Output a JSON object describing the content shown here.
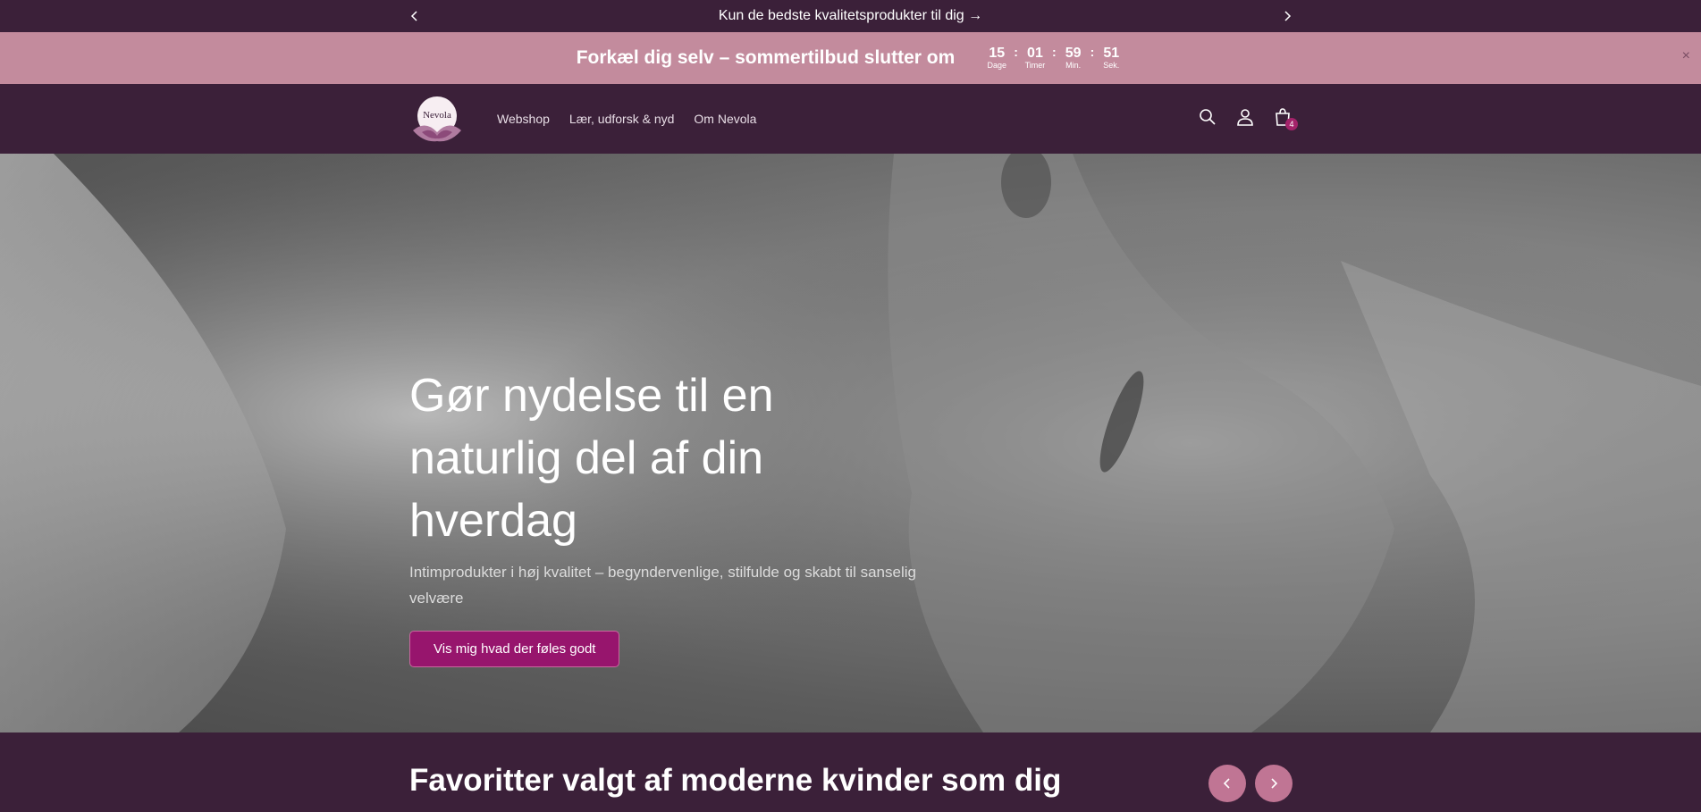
{
  "announcement": {
    "text": "Kun de bedste kvalitetsprodukter til dig →"
  },
  "countdown": {
    "title": "Forkæl dig selv – sommertilbud slutter om",
    "units": [
      {
        "value": "15",
        "label": "Dage"
      },
      {
        "value": "01",
        "label": "Timer"
      },
      {
        "value": "59",
        "label": "Min."
      },
      {
        "value": "51",
        "label": "Sek."
      }
    ],
    "separator": ":",
    "close": "×"
  },
  "header": {
    "logo_text": "Nevola",
    "nav": [
      "Webshop",
      "Lær, udforsk & nyd",
      "Om Nevola"
    ],
    "cart_count": "4"
  },
  "hero": {
    "title": "Gør nydelse til en naturlig del af din hverdag",
    "subtitle": "Intimprodukter i høj kvalitet – begyndervenlige, stilfulde og skabt til sanselig velvære",
    "cta": "Vis mig hvad der føles godt"
  },
  "favorites": {
    "title": "Favoritter valgt af moderne kvinder som dig"
  },
  "colors": {
    "brand_dark": "#3b2039",
    "banner_pink": "#c38b9d",
    "cta_magenta": "#97156d",
    "carousel_pink": "#c07594"
  },
  "icons": [
    "chevron-left-icon",
    "chevron-right-icon",
    "close-icon",
    "search-icon",
    "account-icon",
    "cart-icon"
  ]
}
